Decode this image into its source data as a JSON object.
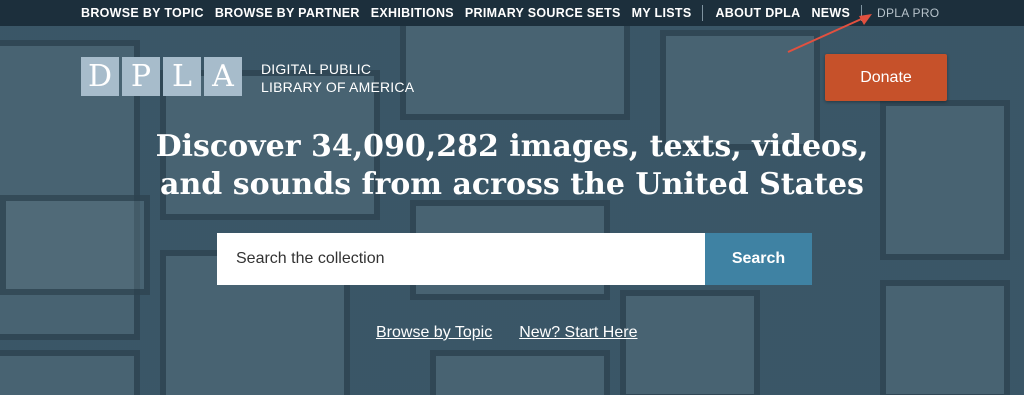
{
  "topnav": {
    "items": [
      {
        "label": "BROWSE BY TOPIC"
      },
      {
        "label": "BROWSE BY PARTNER"
      },
      {
        "label": "EXHIBITIONS"
      },
      {
        "label": "PRIMARY SOURCE SETS"
      },
      {
        "label": "MY LISTS"
      },
      {
        "label": "ABOUT DPLA"
      },
      {
        "label": "NEWS"
      }
    ],
    "pro_label": "DPLA PRO"
  },
  "logo": {
    "letters": [
      "D",
      "P",
      "L",
      "A"
    ],
    "text": "DIGITAL PUBLIC LIBRARY OF AMERICA"
  },
  "donate_label": "Donate",
  "headline": "Discover 34,090,282 images, texts, videos, and sounds from across the United States",
  "search": {
    "placeholder": "Search the collection",
    "button_label": "Search"
  },
  "links": {
    "browse_topic": "Browse by Topic",
    "start_here": "New? Start Here"
  },
  "colors": {
    "nav_bg": "#1c2f3c",
    "donate": "#c6512a",
    "search_button": "#3f82a3",
    "logo_tile": "#a7bccb",
    "annotation_arrow": "#e2503f"
  },
  "icons": {
    "annotation": "red-arrow-icon"
  }
}
